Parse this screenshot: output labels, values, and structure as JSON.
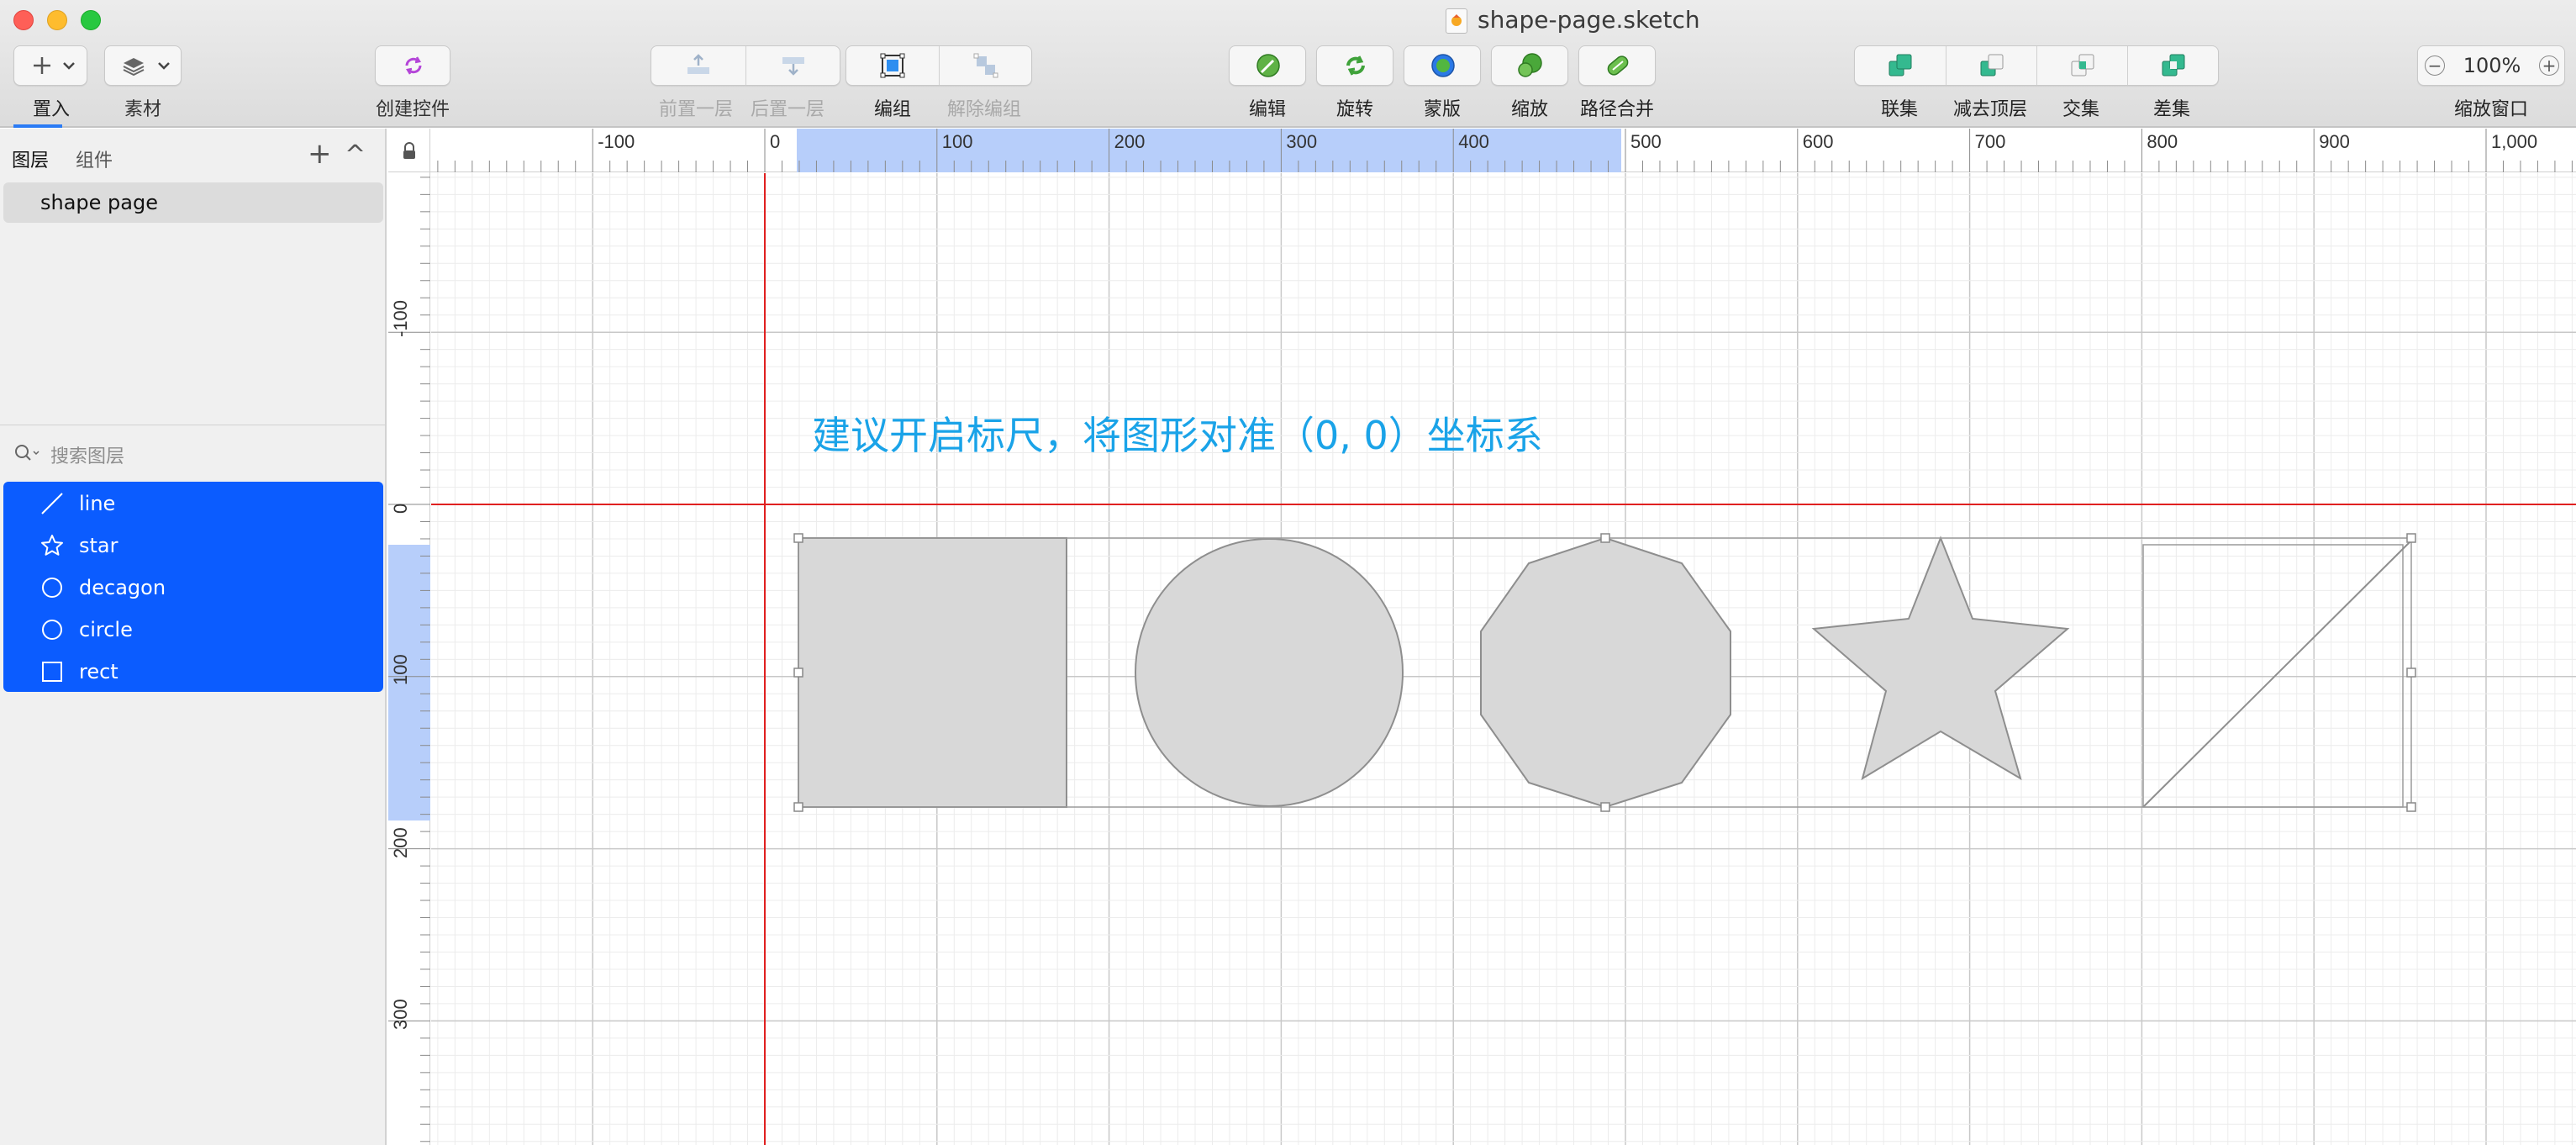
{
  "window": {
    "title": "shape-page.sketch"
  },
  "toolbar": {
    "insert_label": "置入",
    "assets_label": "素材",
    "create_symbol_label": "创建控件",
    "forward_label": "前置一层",
    "backward_label": "后置一层",
    "group_label": "编组",
    "ungroup_label": "解除编组",
    "edit_label": "编辑",
    "rotate_label": "旋转",
    "mask_label": "蒙版",
    "scale_label": "缩放",
    "flatten_label": "路径合并",
    "union_label": "联集",
    "subtract_label": "减去顶层",
    "intersect_label": "交集",
    "difference_label": "差集",
    "zoom_value": "100%",
    "zoom_label": "缩放窗口",
    "zoom_minus": "−",
    "zoom_plus": "+"
  },
  "sidebar": {
    "tab_layers": "图层",
    "tab_components": "组件",
    "add_glyph": "+",
    "collapse_glyph": "^",
    "page_name": "shape page",
    "search_placeholder": "搜索图层",
    "layers": [
      {
        "name": "line",
        "icon": "line-icon"
      },
      {
        "name": "star",
        "icon": "star-icon"
      },
      {
        "name": "decagon",
        "icon": "circle-icon"
      },
      {
        "name": "circle",
        "icon": "circle-icon"
      },
      {
        "name": "rect",
        "icon": "square-icon"
      }
    ],
    "selection_color": "#0b5cff"
  },
  "ruler": {
    "h_labels": [
      "-100",
      "0",
      "100",
      "200",
      "300",
      "400",
      "500",
      "600",
      "700",
      "800",
      "900",
      "1,000"
    ],
    "v_labels": [
      "-100",
      "0",
      "100",
      "200",
      "300"
    ]
  },
  "canvas": {
    "hint_text": "建议开启标尺，将图形对准（0, 0）坐标系",
    "hint_color": "#1aa3e8",
    "guide_color": "#e02020",
    "selection_highlight": "#b7cefa",
    "shape_fill": "#d8d8d8",
    "shape_stroke": "#8e8e8e"
  }
}
